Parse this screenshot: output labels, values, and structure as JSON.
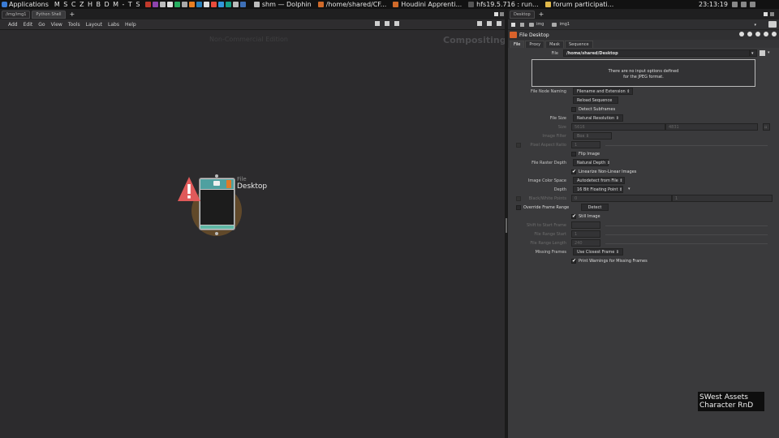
{
  "taskbar": {
    "apps_label": "Applications",
    "quick_launch": [
      "M",
      "S",
      "C",
      "Z",
      "H",
      "B",
      "D",
      "M",
      "-",
      "T",
      "S"
    ],
    "windows": [
      {
        "label": "shm — Dolphin"
      },
      {
        "label": "/home/shared/CF..."
      },
      {
        "label": "Houdini Apprenti..."
      },
      {
        "label": "hfs19.5.716 : run..."
      },
      {
        "label": "forum participati..."
      }
    ],
    "clock": "23:13:19"
  },
  "left_pane": {
    "tabs": [
      {
        "label": "/img/img1"
      },
      {
        "label": "Python Shell"
      }
    ],
    "add_tab": "+",
    "menu": [
      "Add",
      "Edit",
      "Go",
      "View",
      "Tools",
      "Layout",
      "Labs",
      "Help"
    ],
    "watermark": "Non-Commercial Edition",
    "context_label": "Compositing",
    "node": {
      "type_label": "File",
      "name": "Desktop"
    }
  },
  "right_pane": {
    "tabs": [
      {
        "label": "Desktop"
      }
    ],
    "add_tab": "+",
    "breadcrumbs": [
      "img",
      "img1"
    ],
    "node_header": "File  Desktop",
    "param_tabs": [
      "File",
      "Proxy",
      "Mask",
      "Sequence"
    ],
    "params": {
      "file_label": "File",
      "file_value": "/home/shared/Desktop",
      "info_text_1": "There are no input options defined",
      "info_text_2": "for the JPEG format.",
      "file_node_naming_label": "File Node Naming",
      "file_node_naming_value": "Filename and Extension",
      "reload_sequence": "Reload Sequence",
      "detect_subframes": "Detect Subframes",
      "file_size_label": "File Size",
      "file_size_value": "Natural Resolution",
      "size_label": "Size",
      "size_w": "5616",
      "size_h": "4831",
      "image_filter_label": "Image Filter",
      "image_filter_value": "Box",
      "pixel_aspect_label": "Pixel Aspect Ratio",
      "pixel_aspect_value": "1",
      "flip_image": "Flip Image",
      "file_raster_depth_label": "File Raster Depth",
      "file_raster_depth_value": "Natural Depth",
      "linearize": "Linearize Non-Linear Images",
      "image_color_space_label": "Image Color Space",
      "image_color_space_value": "Autodetect from File",
      "depth_label": "Depth",
      "depth_value": "16 Bit Floating Point",
      "bw_points_label": "Black/White Points",
      "bw_black": "0",
      "bw_white": "1",
      "override_frame_range": "Override Frame Range",
      "detect": "Detect",
      "still_image": "Still Image",
      "shift_to_start_label": "Shift to Start Frame",
      "file_range_start_label": "File Range Start",
      "file_range_start_value": "1",
      "file_range_length_label": "File Range Length",
      "file_range_length_value": "240",
      "missing_frames_label": "Missing Frames",
      "missing_frames_value": "Use Closest Frame",
      "print_warnings": "Print Warnings for Missing Frames"
    },
    "checkbox_states": {
      "detect_subframes": false,
      "pixel_aspect": false,
      "flip_image": false,
      "linearize": true,
      "bw_points": false,
      "override_frame_range": false,
      "still_image": true,
      "print_warnings": true
    }
  },
  "brand": {
    "line1": "SWest Assets",
    "line2": "Character RnD"
  },
  "colors": {
    "accent_node": "#d9622b",
    "warning": "#e05a5a",
    "thumb_teal": "#4fa0a0"
  }
}
